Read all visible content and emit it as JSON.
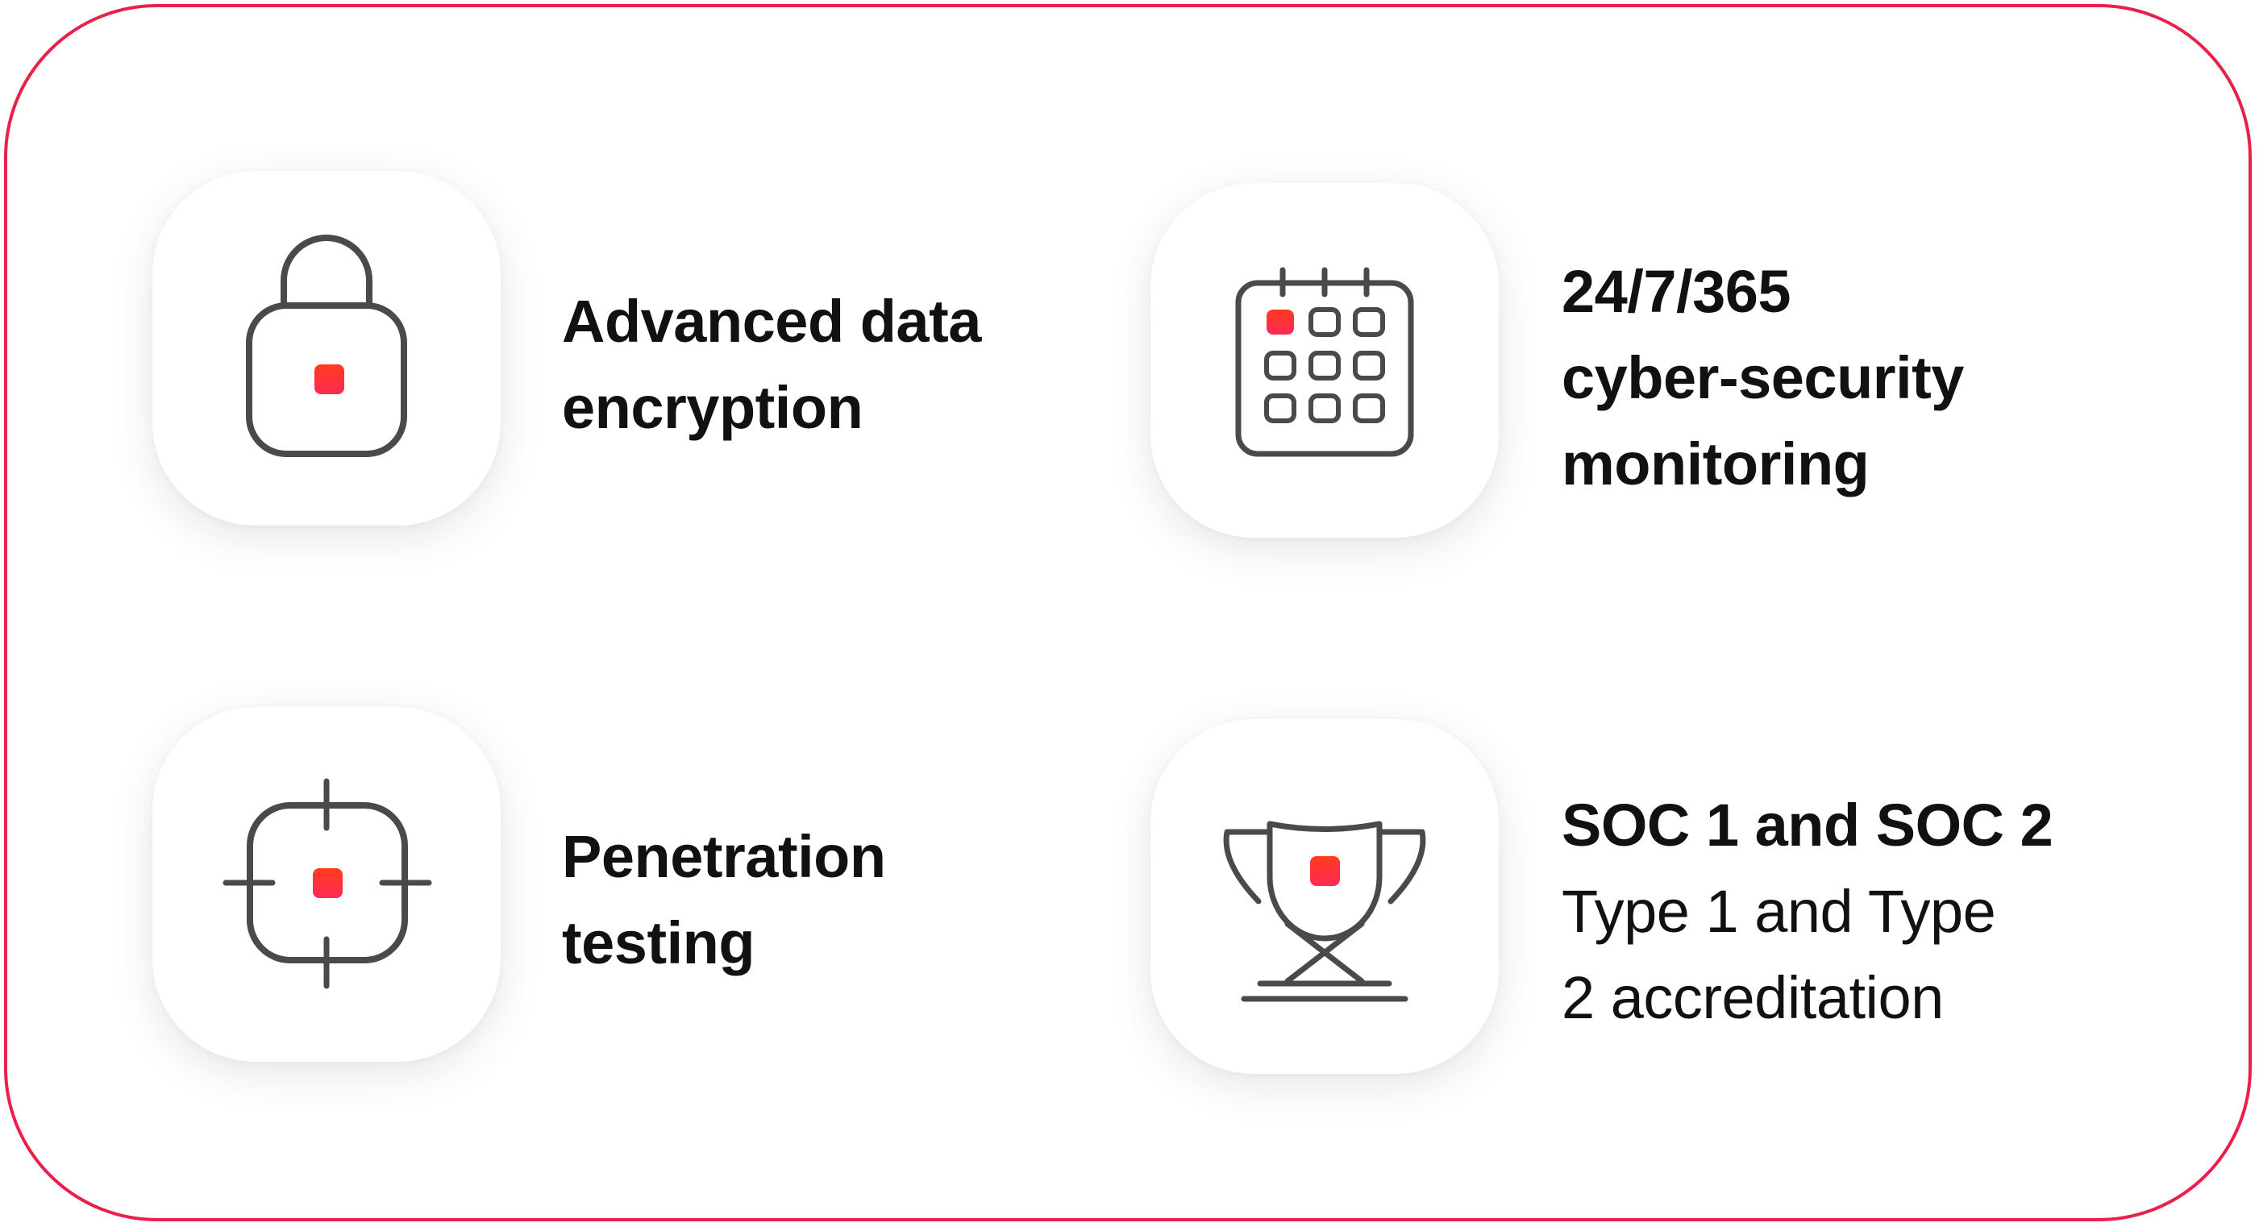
{
  "colors": {
    "border": "#e8204a",
    "icon_stroke": "#4a4a4a",
    "accent_top": "#ff3b1f",
    "accent_bottom": "#ff2a55",
    "text": "#111111"
  },
  "features": [
    {
      "icon": "padlock-icon",
      "lines": [
        "Advanced data",
        "encryption"
      ]
    },
    {
      "icon": "calendar-icon",
      "lines": [
        "24/7/365",
        "cyber-security",
        "monitoring"
      ]
    },
    {
      "icon": "crosshair-target-icon",
      "lines": [
        "Penetration",
        "testing"
      ]
    },
    {
      "icon": "trophy-icon",
      "lines": [
        "SOC 1 and SOC 2",
        "Type 1 and Type",
        "2 accreditation"
      ]
    }
  ]
}
